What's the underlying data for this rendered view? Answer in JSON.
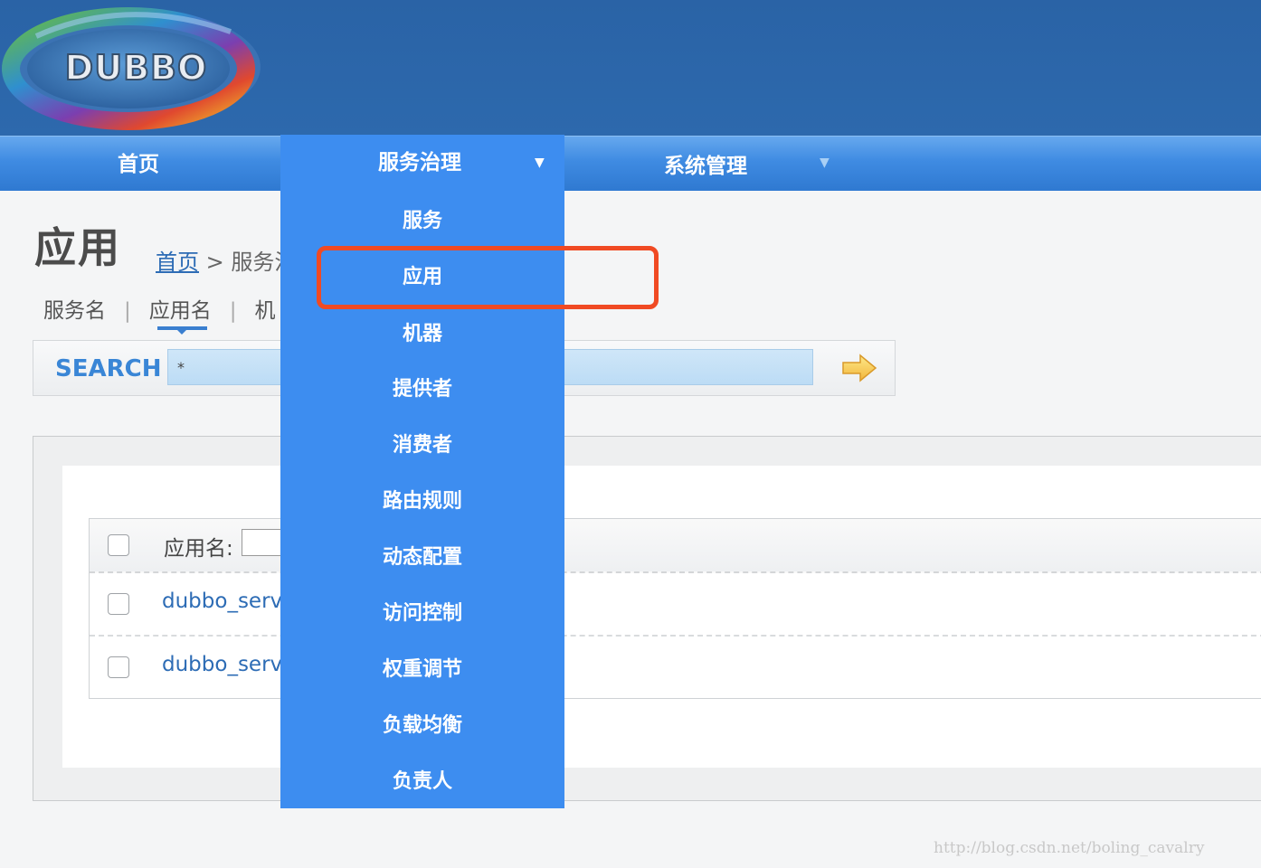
{
  "header": {
    "logo_text": "DUBBO"
  },
  "nav": {
    "home": "首页",
    "service_governance": "服务治理",
    "system_management": "系统管理",
    "caret": "▼"
  },
  "dropdown": {
    "items": [
      "服务",
      "应用",
      "机器",
      "提供者",
      "消费者",
      "路由规则",
      "动态配置",
      "访问控制",
      "权重调节",
      "负载均衡",
      "负责人"
    ],
    "highlighted": "应用",
    "highlight_color": "#f04a23"
  },
  "page": {
    "title": "应用",
    "breadcrumb": {
      "home": "首页",
      "sep": ">",
      "current": "服务治"
    }
  },
  "tabs": {
    "items": [
      "服务名",
      "应用名",
      "机"
    ],
    "sep": "|",
    "active": "应用名"
  },
  "search": {
    "label": "SEARCH",
    "value": "*",
    "go_icon": "arrow-right-icon"
  },
  "table": {
    "header_label": "应用名:",
    "rows": [
      "dubbo_servi",
      "dubbo_servi"
    ]
  },
  "watermark": "http://blog.csdn.net/boling_cavalry",
  "colors": {
    "header": "#2a63a6",
    "nav": "#3f8be2",
    "dropdown": "#3d8df0",
    "link": "#2d6cb5"
  }
}
